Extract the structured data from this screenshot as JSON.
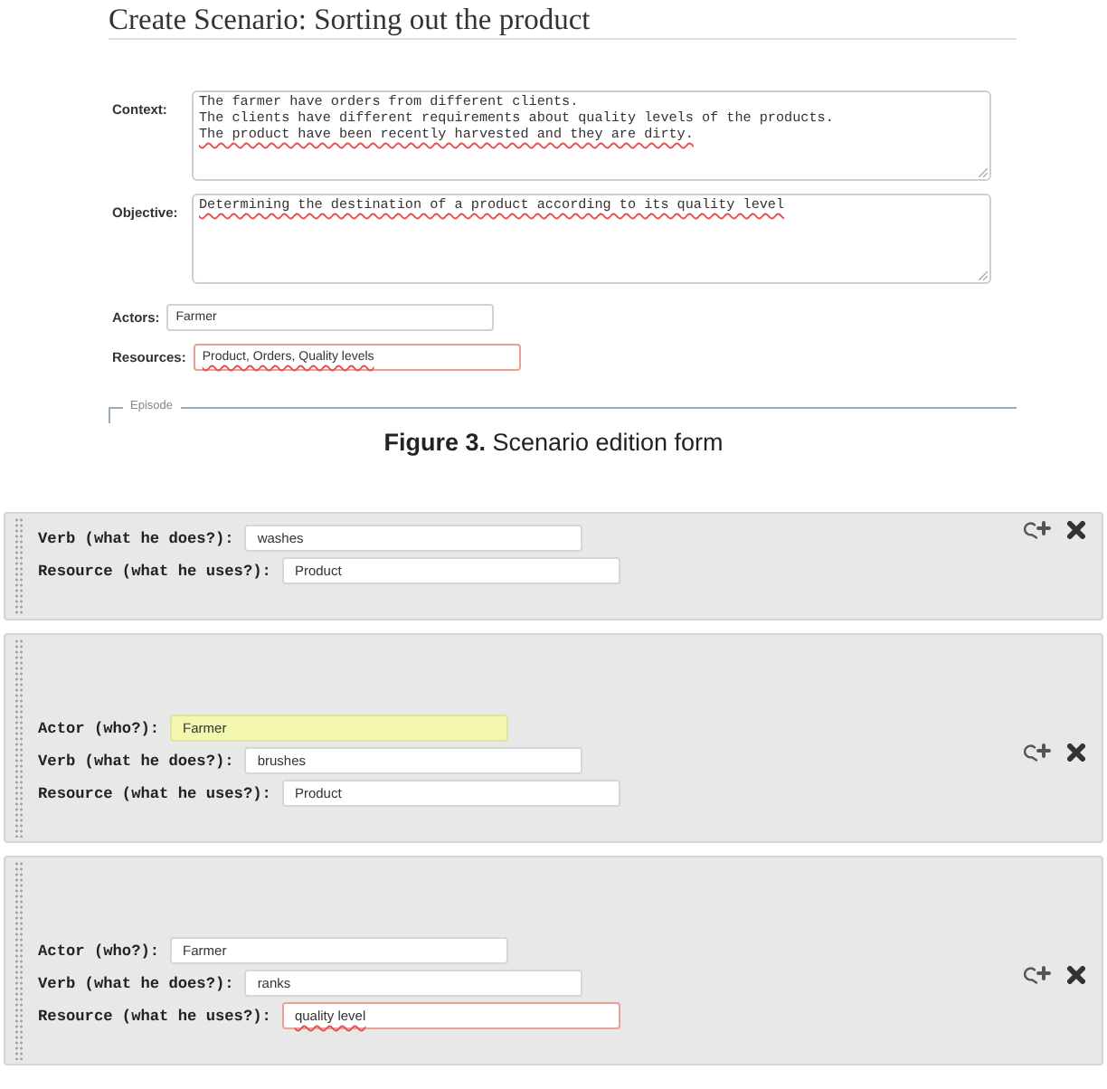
{
  "scenario_form": {
    "title": "Create Scenario: Sorting out the product",
    "text_areas": [
      {
        "label": "Context:",
        "lines": [
          {
            "text": "The farmer have orders from different clients.",
            "underlined": false
          },
          {
            "text": "The clients have different requirements about quality levels of the products.",
            "underlined": false
          },
          {
            "text": "The product have been recently harvested and they are dirty.",
            "underlined": true
          }
        ]
      },
      {
        "label": "Objective:",
        "lines": [
          {
            "text": "Determining the destination of a product according to its quality level",
            "underlined": true
          }
        ]
      }
    ],
    "inputs": [
      {
        "label": "Actors:",
        "value": "Farmer",
        "invalid": false,
        "underlined": false
      },
      {
        "label": "Resources:",
        "value": "Product, Orders, Quality levels",
        "invalid": true,
        "underlined": true
      }
    ],
    "fieldset": {
      "legend": "Episode"
    }
  },
  "caption": "**Figure 3.** Scenario edition form",
  "episode_steps": [
    {
      "fields": [
        {
          "label": "Verb (what he does?):",
          "value": "washes",
          "highlighted": false,
          "invalid": false,
          "underlined": false
        },
        {
          "label": "Resource (what he uses?):",
          "value": "Product",
          "highlighted": false,
          "invalid": false,
          "underlined": false
        }
      ]
    },
    {
      "fields": [
        {
          "label": "Actor (who?):",
          "value": "Farmer",
          "highlighted": true,
          "invalid": false,
          "underlined": false
        },
        {
          "label": "Verb (what he does?):",
          "value": "brushes",
          "highlighted": false,
          "invalid": false,
          "underlined": false
        },
        {
          "label": "Resource (what he uses?):",
          "value": "Product",
          "highlighted": false,
          "invalid": false,
          "underlined": false
        }
      ]
    },
    {
      "fields": [
        {
          "label": "Actor (who?):",
          "value": "Farmer",
          "highlighted": false,
          "invalid": false,
          "underlined": false
        },
        {
          "label": "Verb (what he does?):",
          "value": "ranks",
          "highlighted": false,
          "invalid": false,
          "underlined": false
        },
        {
          "label": "Resource (what he uses?):",
          "value": "quality level",
          "highlighted": false,
          "invalid": true,
          "underlined": true
        }
      ]
    }
  ]
}
